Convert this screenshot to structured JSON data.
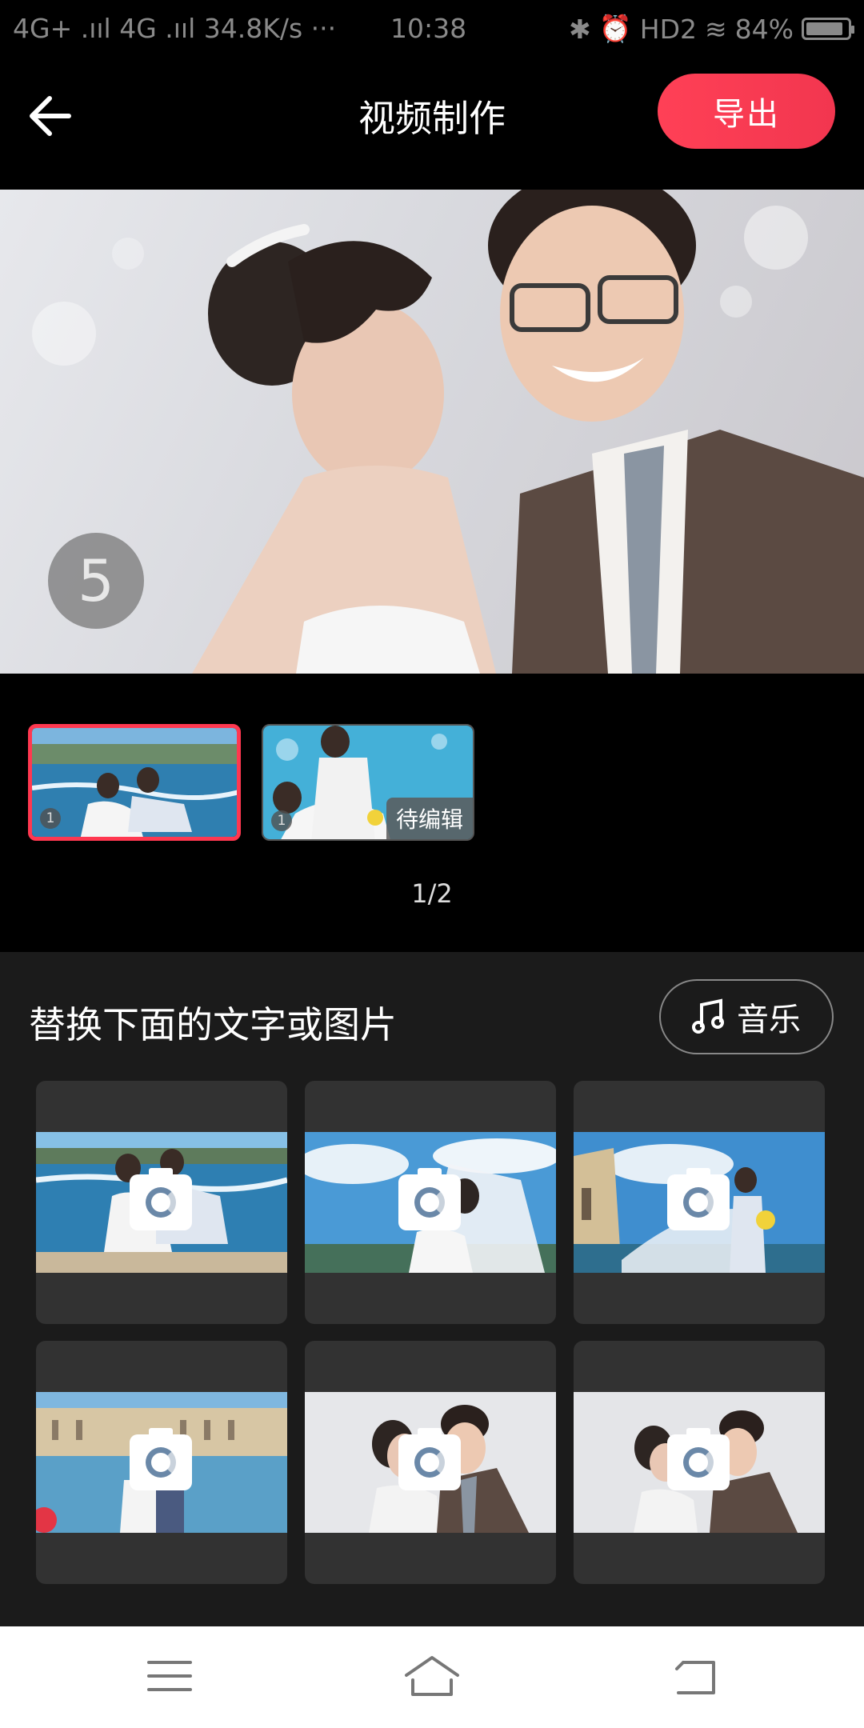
{
  "status_bar": {
    "network": "4G+ .ııl 4G .ııl 34.8K/s ···",
    "time": "10:38",
    "indicators": "HD2",
    "battery": "84%"
  },
  "header": {
    "title": "视频制作",
    "export_label": "导出",
    "accent_color": "#f53a52"
  },
  "preview": {
    "counter": "5"
  },
  "thumbnails": [
    {
      "number": "1",
      "selected": true
    },
    {
      "number": "1",
      "badge": "待编辑"
    }
  ],
  "page_indicator": "1/2",
  "panel": {
    "title": "替换下面的文字或图片",
    "music_label": "音乐"
  },
  "media_cards": [
    {
      "scene": "beach"
    },
    {
      "scene": "sky-veil"
    },
    {
      "scene": "castle"
    },
    {
      "scene": "palace-flowers"
    },
    {
      "scene": "studio"
    },
    {
      "scene": "studio-close"
    }
  ],
  "nav": {
    "icons": [
      "menu-icon",
      "home-icon",
      "back-icon"
    ]
  }
}
